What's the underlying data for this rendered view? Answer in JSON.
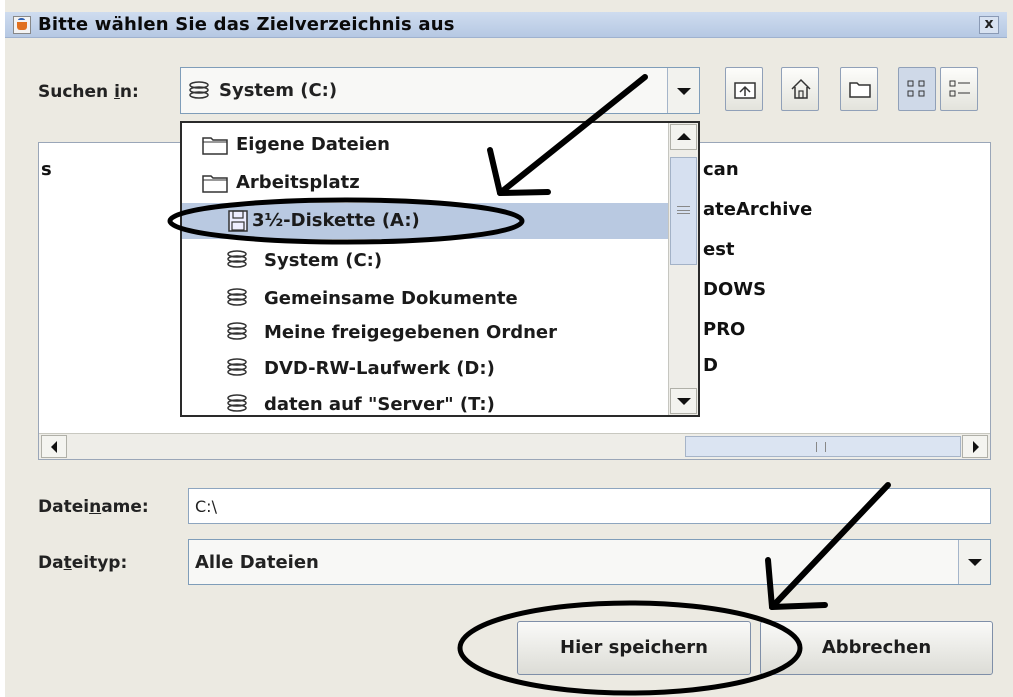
{
  "window": {
    "title": "Bitte wählen Sie das Zielverzeichnis aus",
    "close_glyph": "x"
  },
  "look_in": {
    "label": "Suchen in:",
    "selected": "System (C:)"
  },
  "toolbar": {
    "buttons": [
      "up-folder-icon",
      "home-icon",
      "new-folder-icon",
      "list-view-icon",
      "details-view-icon"
    ]
  },
  "dropdown": {
    "items": [
      {
        "label": "Eigene Dateien",
        "icon": "folder-icon"
      },
      {
        "label": "Arbeitsplatz",
        "icon": "folder-icon"
      },
      {
        "label": "3½-Diskette (A:)",
        "icon": "floppy-icon",
        "selected": true
      },
      {
        "label": "System (C:)",
        "icon": "drive-icon"
      },
      {
        "label": "Gemeinsame Dokumente",
        "icon": "drive-icon"
      },
      {
        "label": "Meine freigegebenen Ordner",
        "icon": "drive-icon"
      },
      {
        "label": "DVD-RW-Laufwerk (D:)",
        "icon": "drive-icon"
      },
      {
        "label": "daten auf \"Server\" (T:)",
        "icon": "drive-icon"
      }
    ]
  },
  "file_list": {
    "partial_left": "s",
    "partial_right": [
      "can",
      "ateArchive",
      "est",
      "DOWS",
      "PRO",
      "D"
    ]
  },
  "filename": {
    "label": "Dateiname:",
    "value": "C:\\"
  },
  "filetype": {
    "label": "Dateityp:",
    "selected": "Alle Dateien"
  },
  "buttons": {
    "save": "Hier speichern",
    "cancel": "Abbrechen"
  },
  "colors": {
    "title_bar": "#c2d2ea",
    "selection": "#b9c9e1",
    "dialog_bg": "#eceae2",
    "annotation": "#000000"
  }
}
